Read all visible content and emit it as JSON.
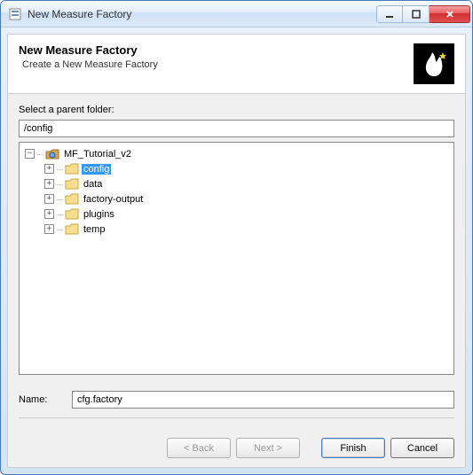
{
  "window": {
    "title": "New Measure Factory"
  },
  "header": {
    "title": "New Measure Factory",
    "subtitle": "Create a New Measure Factory"
  },
  "folderSection": {
    "label": "Select a parent folder:",
    "pathValue": "/config"
  },
  "tree": {
    "root": {
      "label": "MF_Tutorial_v2",
      "expanded": true
    },
    "items": [
      {
        "label": "config",
        "selected": true
      },
      {
        "label": "data",
        "selected": false
      },
      {
        "label": "factory-output",
        "selected": false
      },
      {
        "label": "plugins",
        "selected": false
      },
      {
        "label": "temp",
        "selected": false
      }
    ]
  },
  "nameSection": {
    "label": "Name:",
    "value": "cfg.factory"
  },
  "buttons": {
    "back": "< Back",
    "next": "Next >",
    "finish": "Finish",
    "cancel": "Cancel"
  },
  "glyphs": {
    "minus": "−",
    "plus": "+",
    "dots": "····"
  }
}
